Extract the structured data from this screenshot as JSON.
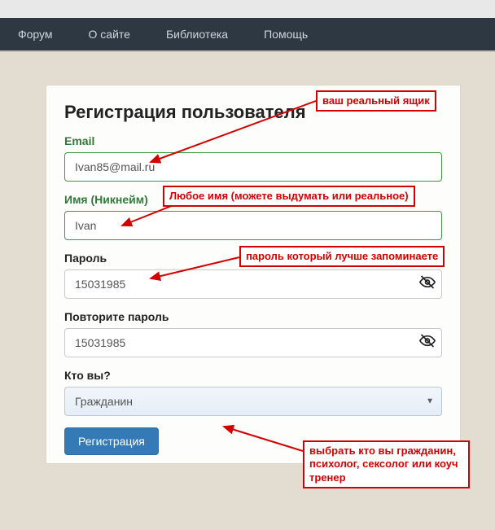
{
  "nav": {
    "forum": "Форум",
    "about": "О сайте",
    "library": "Библиотека",
    "help": "Помощь"
  },
  "form": {
    "title": "Регистрация пользователя",
    "email_label": "Email",
    "email_value": "Ivan85@mail.ru",
    "name_label": "Имя (Никнейм)",
    "name_value": "Ivan",
    "password_label": "Пароль",
    "password_value": "15031985",
    "password2_label": "Повторите пароль",
    "password2_value": "15031985",
    "who_label": "Кто вы?",
    "who_value": "Гражданин",
    "submit": "Регистрация"
  },
  "annotations": {
    "a1": "ваш реальный ящик",
    "a2": "Любое имя (можете выдумать или реальное)",
    "a3": "пароль который лучше запоминаете",
    "a4": "выбрать кто вы гражданин, психолог, сексолог или коуч тренер"
  }
}
